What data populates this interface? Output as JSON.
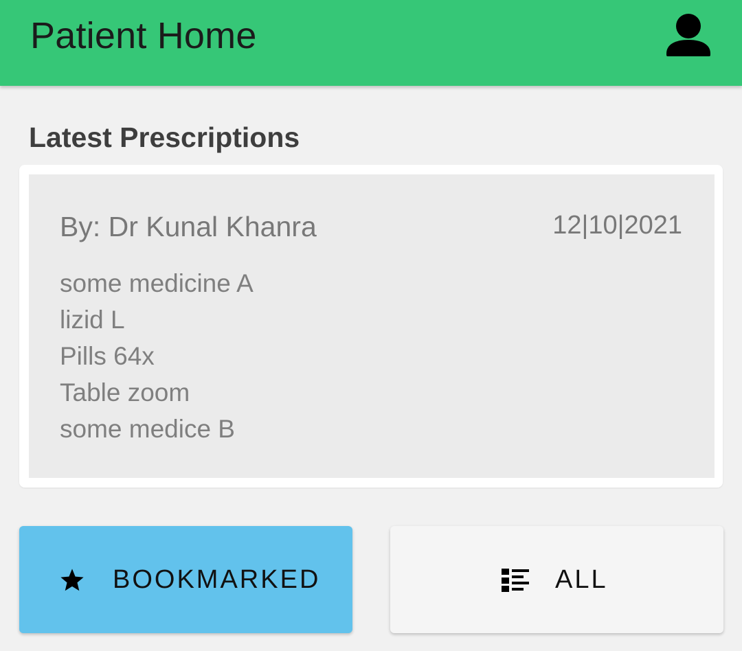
{
  "app_bar": {
    "title": "Patient Home",
    "profile_icon": "account-icon",
    "color": "#36c777"
  },
  "section": {
    "title": "Latest Prescriptions"
  },
  "prescription": {
    "doctor": "By: Dr Kunal Khanra",
    "date": "12|10|2021",
    "medicines": [
      "some medicine A",
      "lizid L",
      "Pills 64x",
      "Table zoom",
      "some medice B"
    ]
  },
  "buttons": {
    "bookmarked": {
      "label": "BOOKMARKED",
      "icon": "star-icon",
      "color": "#62c2ec"
    },
    "all": {
      "label": "ALL",
      "icon": "list-icon",
      "color": "#f5f5f5"
    }
  }
}
